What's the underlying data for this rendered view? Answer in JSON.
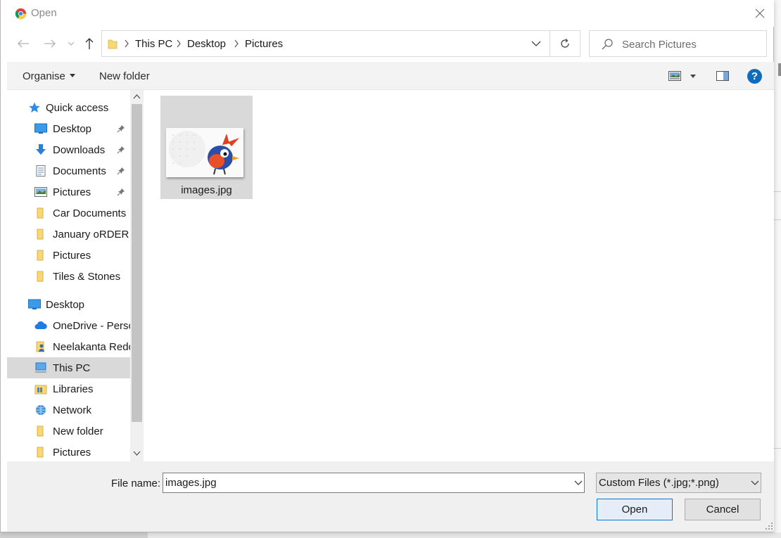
{
  "window": {
    "title": "Open",
    "app_icon": "chrome-icon"
  },
  "address": {
    "breadcrumbs": [
      "This PC",
      "Desktop",
      "Pictures"
    ]
  },
  "search": {
    "placeholder": "Search Pictures"
  },
  "toolbar": {
    "organise_label": "Organise",
    "new_folder_label": "New folder",
    "help_label": "?"
  },
  "nav_pane": {
    "items": [
      {
        "label": "Quick access",
        "icon": "star-icon",
        "pinned": false
      },
      {
        "label": "Desktop",
        "icon": "desktop-icon",
        "pinned": true
      },
      {
        "label": "Downloads",
        "icon": "download-icon",
        "pinned": true
      },
      {
        "label": "Documents",
        "icon": "document-icon",
        "pinned": true
      },
      {
        "label": "Pictures",
        "icon": "pictures-icon",
        "pinned": true
      },
      {
        "label": "Car Documents",
        "icon": "folder-icon",
        "pinned": false
      },
      {
        "label": "January oRDER",
        "icon": "folder-icon",
        "pinned": false
      },
      {
        "label": "Pictures",
        "icon": "folder-icon",
        "pinned": false
      },
      {
        "label": "Tiles & Stones",
        "icon": "folder-icon",
        "pinned": false
      },
      {
        "label": "Desktop",
        "icon": "desktop-icon",
        "pinned": false
      },
      {
        "label": "OneDrive - Perso",
        "icon": "cloud-icon",
        "pinned": false
      },
      {
        "label": "Neelakanta Redd",
        "icon": "user-folder-icon",
        "pinned": false
      },
      {
        "label": "This PC",
        "icon": "computer-icon",
        "pinned": false,
        "selected": true
      },
      {
        "label": "Libraries",
        "icon": "library-icon",
        "pinned": false
      },
      {
        "label": "Network",
        "icon": "network-icon",
        "pinned": false
      },
      {
        "label": "New folder",
        "icon": "folder-icon",
        "pinned": false
      },
      {
        "label": "Pictures",
        "icon": "folder-icon",
        "pinned": false
      }
    ]
  },
  "files": [
    {
      "name": "images.jpg",
      "selected": true
    }
  ],
  "bottom": {
    "file_name_label": "File name:",
    "file_name_value": "images.jpg",
    "file_type_value": "Custom Files (*.jpg;*.png)",
    "open_label": "Open",
    "cancel_label": "Cancel"
  },
  "colors": {
    "accent": "#0078d7",
    "selection": "#d9d9d9",
    "help_blue": "#0f6cbd",
    "folder_yellow": "#f8d775"
  }
}
